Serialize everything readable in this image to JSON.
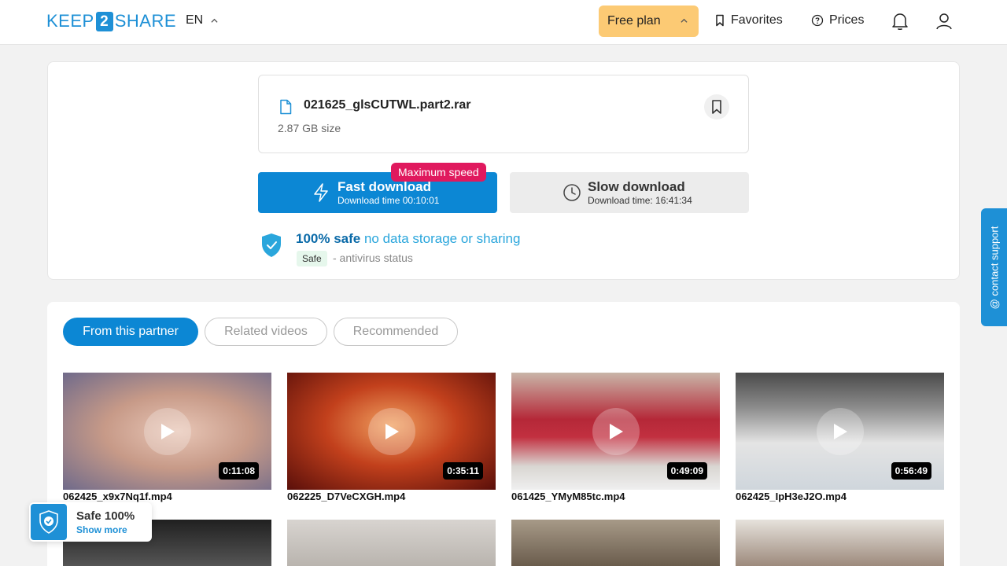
{
  "header": {
    "logo_left": "KEEP",
    "logo_mid": "2",
    "logo_right": "SHARE",
    "language": "EN",
    "plan_label": "Free plan",
    "favorites_label": "Favorites",
    "prices_label": "Prices"
  },
  "file": {
    "name": "021625_glsCUTWL.part2.rar",
    "size": "2.87 GB size"
  },
  "fast_download": {
    "badge": "Maximum speed",
    "title": "Fast download",
    "time": "Download time 00:10:01"
  },
  "slow_download": {
    "title": "Slow download",
    "time": "Download time: 16:41:34"
  },
  "safety": {
    "strong": "100% safe",
    "light": " no data storage or sharing",
    "tag": "Safe",
    "desc": "- antivirus status"
  },
  "tabs": [
    "From this partner",
    "Related videos",
    "Recommended"
  ],
  "videos": [
    {
      "name": "062425_x9x7Nq1f.mp4",
      "duration": "0:11:08"
    },
    {
      "name": "062225_D7VeCXGH.mp4",
      "duration": "0:35:11"
    },
    {
      "name": "061425_YMyM85tc.mp4",
      "duration": "0:49:09"
    },
    {
      "name": "062425_IpH3eJ2O.mp4",
      "duration": "0:56:49"
    }
  ],
  "support_label": "@ contact support",
  "safe_widget": {
    "title": "Safe 100%",
    "link": "Show more"
  },
  "colors": {
    "brand": "#1e90d6",
    "fast_button": "#0c87d4",
    "badge": "#e0195e",
    "plan": "#fcca74"
  }
}
